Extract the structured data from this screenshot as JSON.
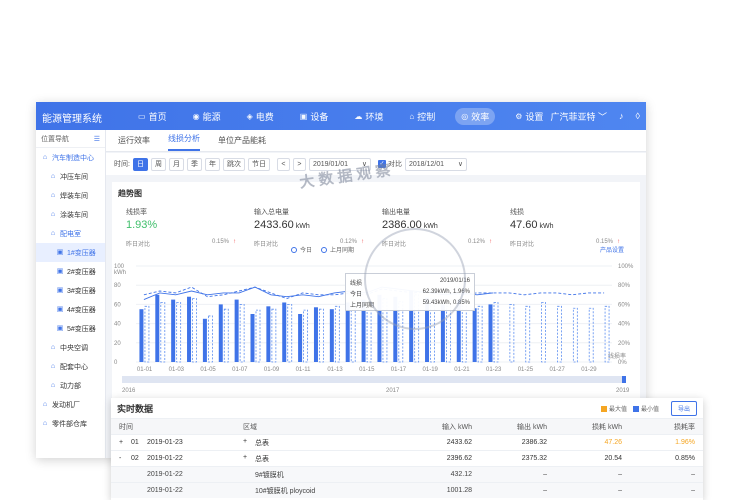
{
  "app": {
    "title": "能源管理系统",
    "nav": [
      {
        "label": "首页",
        "icon": "home-icon",
        "glyph": "▭"
      },
      {
        "label": "能源",
        "icon": "energy-icon",
        "glyph": "◉"
      },
      {
        "label": "电费",
        "icon": "location-icon",
        "glyph": "◈"
      },
      {
        "label": "设备",
        "icon": "device-icon",
        "glyph": "▣"
      },
      {
        "label": "环境",
        "icon": "cloud-icon",
        "glyph": "☁"
      },
      {
        "label": "控制",
        "icon": "control-icon",
        "glyph": "⌂"
      },
      {
        "label": "效率",
        "icon": "efficiency-icon",
        "glyph": "◎"
      },
      {
        "label": "设置",
        "icon": "settings-icon",
        "glyph": "⚙"
      }
    ],
    "active_nav": 6,
    "company": "广汽菲亚特",
    "company_chevron": "﹀",
    "bell_glyph": "♪",
    "drop_glyph": "◊"
  },
  "sidebar": {
    "title": "位置导航",
    "menu_glyph": "☰",
    "items": [
      {
        "label": "汽车制造中心",
        "level": 0,
        "state": "active",
        "icon": "building-icon",
        "glyph": "⌂"
      },
      {
        "label": "冲压车间",
        "level": 1,
        "state": "",
        "icon": "workshop-icon",
        "glyph": "⌂"
      },
      {
        "label": "焊装车间",
        "level": 1,
        "state": "",
        "icon": "workshop-icon",
        "glyph": "⌂"
      },
      {
        "label": "涂装车间",
        "level": 1,
        "state": "",
        "icon": "workshop-icon",
        "glyph": "⌂"
      },
      {
        "label": "配电室",
        "level": 1,
        "state": "active",
        "icon": "power-room-icon",
        "glyph": "⌂"
      },
      {
        "label": "1#变压器",
        "level": 2,
        "state": "sel",
        "icon": "transformer-icon",
        "glyph": "▣"
      },
      {
        "label": "2#变压器",
        "level": 2,
        "state": "",
        "icon": "transformer-icon",
        "glyph": "▣"
      },
      {
        "label": "3#变压器",
        "level": 2,
        "state": "",
        "icon": "transformer-icon",
        "glyph": "▣"
      },
      {
        "label": "4#变压器",
        "level": 2,
        "state": "",
        "icon": "transformer-icon",
        "glyph": "▣"
      },
      {
        "label": "5#变压器",
        "level": 2,
        "state": "",
        "icon": "transformer-icon",
        "glyph": "▣"
      },
      {
        "label": "中央空调",
        "level": 1,
        "state": "",
        "icon": "aircon-icon",
        "glyph": "⌂"
      },
      {
        "label": "配套中心",
        "level": 1,
        "state": "",
        "icon": "support-icon",
        "glyph": "⌂"
      },
      {
        "label": "动力部",
        "level": 1,
        "state": "",
        "icon": "power-icon",
        "glyph": "⌂"
      },
      {
        "label": "发动机厂",
        "level": 0,
        "state": "",
        "icon": "engine-icon",
        "glyph": "⌂"
      },
      {
        "label": "零件部仓库",
        "level": 0,
        "state": "",
        "icon": "warehouse-icon",
        "glyph": "⌂"
      }
    ]
  },
  "tabs": [
    "运行效率",
    "线损分析",
    "单位产品能耗"
  ],
  "active_tab": 1,
  "toolbar": {
    "time_label": "时间:",
    "periods": [
      "日",
      "周",
      "月",
      "季",
      "年",
      "跳次",
      "节日"
    ],
    "active_period": 0,
    "prev": "<",
    "next": ">",
    "date": "2019/01/01",
    "compare_label": "对比",
    "compare_checked": "✓",
    "compare_date": "2018/12/01",
    "dropdown": "∨"
  },
  "panel": {
    "title": "趋势图",
    "kpis": [
      {
        "label": "线损率",
        "value": "1.93%",
        "unit": "",
        "green": true,
        "sub_label": "昨日对比",
        "sub_value": "0.15%",
        "arrow": "↑"
      },
      {
        "label": "输入总电量",
        "value": "2433.60",
        "unit": "kWh",
        "green": false,
        "sub_label": "昨日对比",
        "sub_value": "0.12%",
        "arrow": "↑"
      },
      {
        "label": "输出电量",
        "value": "2386.00",
        "unit": "kWh",
        "green": false,
        "sub_label": "昨日对比",
        "sub_value": "0.12%",
        "arrow": "↑"
      },
      {
        "label": "线损",
        "value": "47.60",
        "unit": "kWh",
        "green": false,
        "sub_label": "昨日对比",
        "sub_value": "0.15%",
        "arrow": "↑"
      }
    ],
    "legend": {
      "today": "今日",
      "last_month": "上月同期"
    },
    "product_setting": "产品设置",
    "tooltip": {
      "title": "线损",
      "date_right": "2019/01/16",
      "row1_label": "今日",
      "row1_value": "62.39kWh, 1.96%",
      "row2_label": "上月同期",
      "row2_value": "59.43kWh, 0.85%"
    },
    "watermark": "大 数 据 观 察"
  },
  "chart_data": {
    "type": "bar",
    "categories": [
      "01-01",
      "01-02",
      "01-03",
      "01-04",
      "01-05",
      "01-06",
      "01-07",
      "01-08",
      "01-09",
      "01-10",
      "01-11",
      "01-12",
      "01-13",
      "01-14",
      "01-15",
      "01-16",
      "01-17",
      "01-18",
      "01-19",
      "01-20",
      "01-21",
      "01-22",
      "01-23",
      "01-24",
      "01-25",
      "01-26",
      "01-27",
      "01-28",
      "01-29",
      "01-30"
    ],
    "x_tick_labels": [
      "01-01",
      "01-03",
      "01-05",
      "01-07",
      "01-09",
      "01-11",
      "01-13",
      "01-15",
      "01-17",
      "01-19",
      "01-21",
      "01-23",
      "01-25",
      "01-27",
      "01-29"
    ],
    "ylabel_left": "kWh",
    "ylabel_right": "线损率",
    "ylim": [
      0,
      100
    ],
    "y2lim": [
      0,
      100
    ],
    "y_ticks": [
      0,
      20,
      40,
      60,
      80,
      100
    ],
    "y2_ticks": [
      "0%",
      "20%",
      "40%",
      "60%",
      "80%",
      "100%"
    ],
    "series": [
      {
        "name": "今日",
        "type": "bar",
        "color": "#3f73e8",
        "values": [
          55,
          70,
          65,
          68,
          45,
          60,
          65,
          50,
          58,
          62,
          50,
          57,
          55,
          62,
          65,
          70,
          68,
          74,
          67,
          60,
          65,
          56,
          60,
          null,
          null,
          null,
          null,
          null,
          null,
          null
        ]
      },
      {
        "name": "上月同期",
        "type": "bar-dashed",
        "color": "#5b8df0",
        "values": [
          58,
          62,
          62,
          66,
          48,
          55,
          60,
          54,
          55,
          60,
          54,
          55,
          58,
          60,
          62,
          66,
          63,
          70,
          66,
          58,
          62,
          58,
          62,
          60,
          58,
          62,
          58,
          56,
          56,
          58
        ]
      },
      {
        "name": "今日线损率",
        "type": "line",
        "color": "#3f73e8",
        "values": [
          65,
          72,
          70,
          74,
          70,
          72,
          72,
          78,
          70,
          68,
          70,
          68,
          72,
          74,
          72,
          78,
          76,
          74,
          72,
          70,
          72,
          70,
          72,
          null,
          null,
          null,
          null,
          null,
          null,
          null
        ]
      },
      {
        "name": "上月同期线损率",
        "type": "line-dashed",
        "color": "#3f73e8",
        "values": [
          70,
          74,
          72,
          78,
          68,
          70,
          74,
          78,
          72,
          66,
          72,
          70,
          70,
          72,
          70,
          76,
          74,
          72,
          74,
          72,
          70,
          72,
          72,
          72,
          70,
          72,
          72,
          70,
          72,
          72
        ]
      }
    ],
    "slider": {
      "left_label": "2016",
      "mid_label": "2017",
      "right_label": "2019"
    }
  },
  "realtime": {
    "title": "实时数据",
    "legend_max": "最大值",
    "legend_min": "最小值",
    "max_color": "#f5a623",
    "min_color": "#3f73e8",
    "export": "导出",
    "headers": {
      "time": "时间",
      "region": "区域",
      "input": "输入 kWh",
      "output": "输出 kWh",
      "loss": "损耗 kWh",
      "rate": "损耗率"
    },
    "rows": [
      {
        "expander": "+",
        "idx": "01",
        "time": "2019-01-23",
        "region_expander": "+",
        "region": "总表",
        "input": "2433.62",
        "output": "2386.32",
        "loss": "47.26",
        "rate": "1.96%",
        "highlight": true,
        "sub": false
      },
      {
        "expander": "-",
        "idx": "02",
        "time": "2019-01-22",
        "region_expander": "+",
        "region": "总表",
        "input": "2396.62",
        "output": "2375.32",
        "loss": "20.54",
        "rate": "0.85%",
        "highlight": false,
        "sub": false
      },
      {
        "expander": "",
        "idx": "",
        "time": "2019-01-22",
        "region_expander": "",
        "region": "9#镀膜机",
        "input": "432.12",
        "output": "–",
        "loss": "–",
        "rate": "–",
        "highlight": false,
        "sub": true
      },
      {
        "expander": "",
        "idx": "",
        "time": "2019-01-22",
        "region_expander": "",
        "region": "10#镀膜机 ploycoid",
        "input": "1001.28",
        "output": "–",
        "loss": "–",
        "rate": "–",
        "highlight": false,
        "sub": true
      }
    ]
  }
}
